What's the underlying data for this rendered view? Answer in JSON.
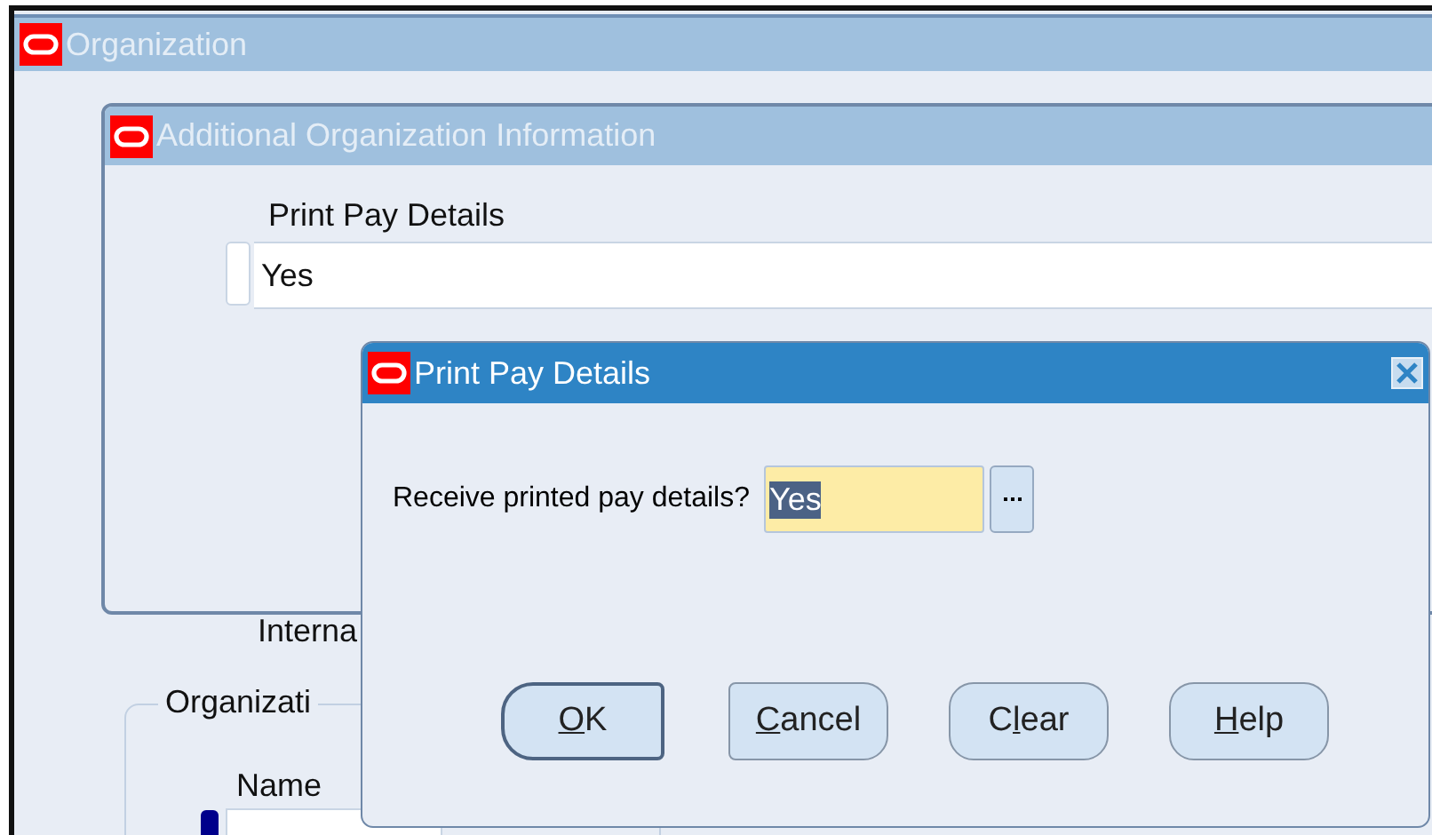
{
  "main_window": {
    "title": "Organization"
  },
  "info_window": {
    "title": "Additional Organization Information",
    "field_label": "Print Pay Details",
    "field_value": "Yes"
  },
  "background_labels": [
    {
      "kind": "label",
      "text": "Interna"
    },
    {
      "kind": "group",
      "text": "Organizati"
    },
    {
      "kind": "label",
      "text": "Name"
    }
  ],
  "dialog": {
    "title": "Print Pay Details",
    "prompt": "Receive printed pay details?",
    "value": "Yes",
    "value_selected": true,
    "buttons": [
      {
        "key": "O",
        "after": "K",
        "default": true
      },
      {
        "key": "C",
        "after": "ancel",
        "default": false
      },
      {
        "before": "C",
        "key": "l",
        "after": "ear",
        "default": false
      },
      {
        "key": "H",
        "after": "elp",
        "default": false
      }
    ]
  }
}
